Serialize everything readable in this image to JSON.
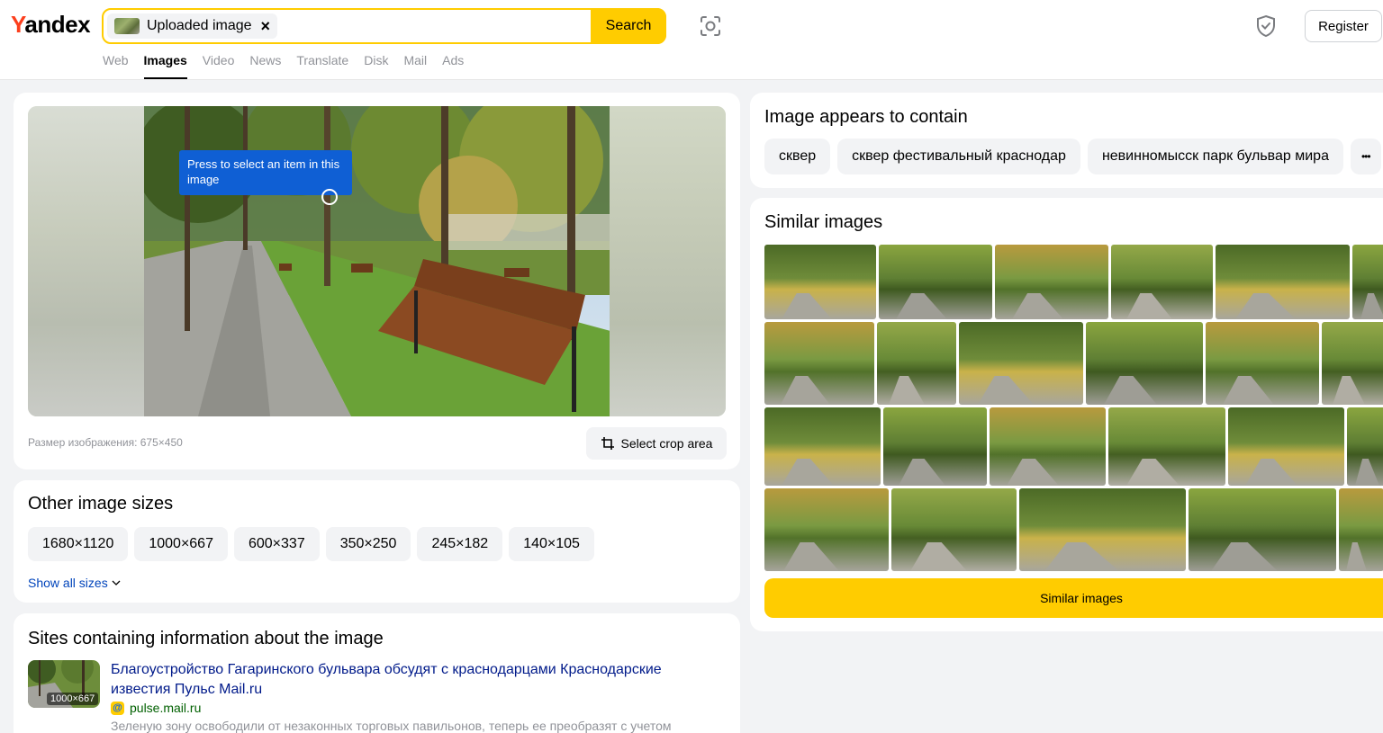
{
  "header": {
    "logo_y": "Y",
    "logo_rest": "andex",
    "chip_label": "Uploaded image",
    "chip_close": "×",
    "search_label": "Search",
    "register_label": "Register",
    "tabs": [
      {
        "label": "Web",
        "active": false
      },
      {
        "label": "Images",
        "active": true
      },
      {
        "label": "Video",
        "active": false
      },
      {
        "label": "News",
        "active": false
      },
      {
        "label": "Translate",
        "active": false
      },
      {
        "label": "Disk",
        "active": false
      },
      {
        "label": "Mail",
        "active": false
      },
      {
        "label": "Ads",
        "active": false
      }
    ]
  },
  "preview": {
    "tooltip": "Press to select an item in this image",
    "size_text": "Размер изображения: 675×450",
    "crop_label": "Select crop area"
  },
  "sizes": {
    "title": "Other image sizes",
    "items": [
      "1680×1120",
      "1000×667",
      "600×337",
      "350×250",
      "245×182",
      "140×105"
    ],
    "show_all": "Show all sizes"
  },
  "sites": {
    "title": "Sites containing information about the image",
    "thumb_res": "1000×667",
    "link_text": "Благоустройство Гагаринского бульвара обсудят с краснодарцами Краснодарские известия Пульс Mail.ru",
    "domain": "pulse.mail.ru",
    "description": "Зеленую зону освободили от незаконных торговых павильонов, теперь ее преобразят с учетом"
  },
  "contains": {
    "title": "Image appears to contain",
    "tags": [
      "сквер",
      "сквер фестивальный краснодар",
      "невинномысск парк бульвар мира"
    ],
    "more": "•••"
  },
  "similar": {
    "title": "Similar images",
    "button_label": "Similar images"
  }
}
